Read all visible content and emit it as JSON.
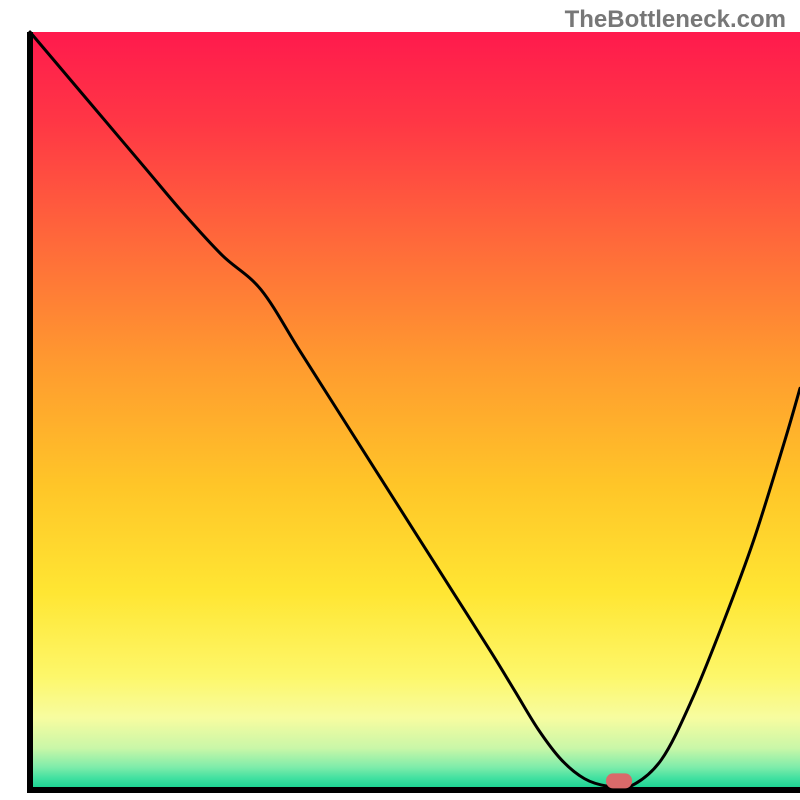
{
  "watermark": "TheBottleneck.com",
  "chart_data": {
    "type": "line",
    "title": "",
    "xlabel": "",
    "ylabel": "",
    "xlim": [
      0,
      100
    ],
    "ylim": [
      0,
      100
    ],
    "background": {
      "type": "vertical-gradient",
      "stops": [
        {
          "offset": 0.0,
          "color": "#ff1a4d"
        },
        {
          "offset": 0.12,
          "color": "#ff3745"
        },
        {
          "offset": 0.28,
          "color": "#ff6a3a"
        },
        {
          "offset": 0.44,
          "color": "#ff9b2f"
        },
        {
          "offset": 0.6,
          "color": "#ffc628"
        },
        {
          "offset": 0.74,
          "color": "#ffe633"
        },
        {
          "offset": 0.85,
          "color": "#fdf76a"
        },
        {
          "offset": 0.905,
          "color": "#f7fca0"
        },
        {
          "offset": 0.945,
          "color": "#c9f7a8"
        },
        {
          "offset": 0.97,
          "color": "#7eecaa"
        },
        {
          "offset": 0.985,
          "color": "#3fe0a0"
        },
        {
          "offset": 1.0,
          "color": "#12d08f"
        }
      ]
    },
    "series": [
      {
        "name": "bottleneck-curve",
        "color": "#000000",
        "x": [
          0,
          5,
          10,
          15,
          20,
          25,
          30,
          35,
          40,
          45,
          50,
          55,
          60,
          63,
          66,
          69,
          72,
          75,
          78,
          82,
          86,
          90,
          94,
          98,
          100
        ],
        "y": [
          100,
          94,
          88,
          82,
          76,
          70.5,
          66,
          58,
          50,
          42,
          34,
          26,
          18,
          13,
          8,
          4,
          1.5,
          0.5,
          0.5,
          4,
          12,
          22,
          33,
          46,
          53
        ]
      }
    ],
    "marker": {
      "name": "optimal-point",
      "x": 76.5,
      "y": 1.2,
      "color": "#d96a6a",
      "shape": "rounded-rect"
    },
    "frame": {
      "left_x": 3.3,
      "right_x": 100,
      "bottom_y": 0,
      "top_y": 100,
      "color": "#000000"
    }
  }
}
